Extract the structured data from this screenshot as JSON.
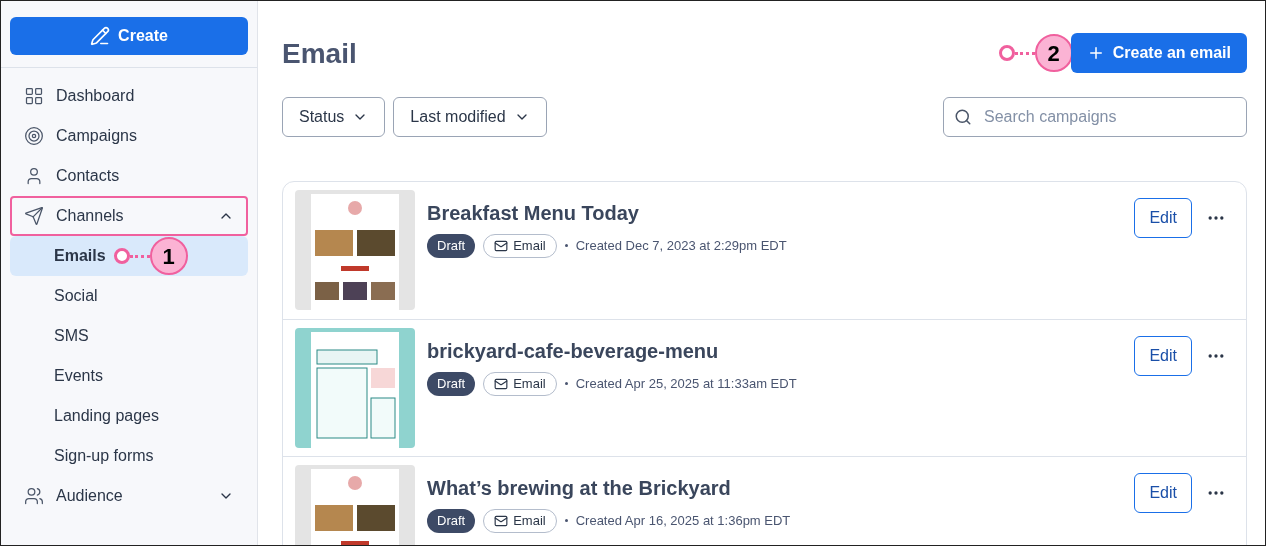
{
  "sidebar": {
    "create_button": "Create",
    "items": [
      {
        "kind": "link",
        "label": "Dashboard",
        "selected": false
      },
      {
        "kind": "link",
        "label": "Campaigns",
        "selected": false
      },
      {
        "kind": "link",
        "label": "Contacts",
        "selected": false
      },
      {
        "kind": "group",
        "label": "Channels",
        "expanded": true,
        "highlighted": true,
        "children": [
          {
            "label": "Emails",
            "selected": true,
            "callout": "1"
          },
          {
            "label": "Social",
            "selected": false
          },
          {
            "label": "SMS",
            "selected": false
          },
          {
            "label": "Events",
            "selected": false
          },
          {
            "label": "Landing pages",
            "selected": false
          },
          {
            "label": "Sign-up forms",
            "selected": false
          }
        ]
      },
      {
        "kind": "group",
        "label": "Audience",
        "expanded": false,
        "highlighted": false
      }
    ]
  },
  "header": {
    "title": "Email",
    "create_button": "Create an email",
    "create_callout": "2"
  },
  "filters": [
    {
      "label": "Status"
    },
    {
      "label": "Last modified"
    }
  ],
  "search": {
    "placeholder": "Search campaigns"
  },
  "campaigns": [
    {
      "title": "Breakfast Menu Today",
      "status": "Draft",
      "type": "Email",
      "created": "Created Dec 7, 2023 at 2:29pm EDT",
      "edit": "Edit"
    },
    {
      "title": "brickyard-cafe-beverage-menu",
      "status": "Draft",
      "type": "Email",
      "created": "Created Apr 25, 2025 at 11:33am EDT",
      "edit": "Edit"
    },
    {
      "title": "What’s brewing at the Brickyard",
      "status": "Draft",
      "type": "Email",
      "created": "Created Apr 16, 2025 at 1:36pm EDT",
      "edit": "Edit"
    }
  ]
}
